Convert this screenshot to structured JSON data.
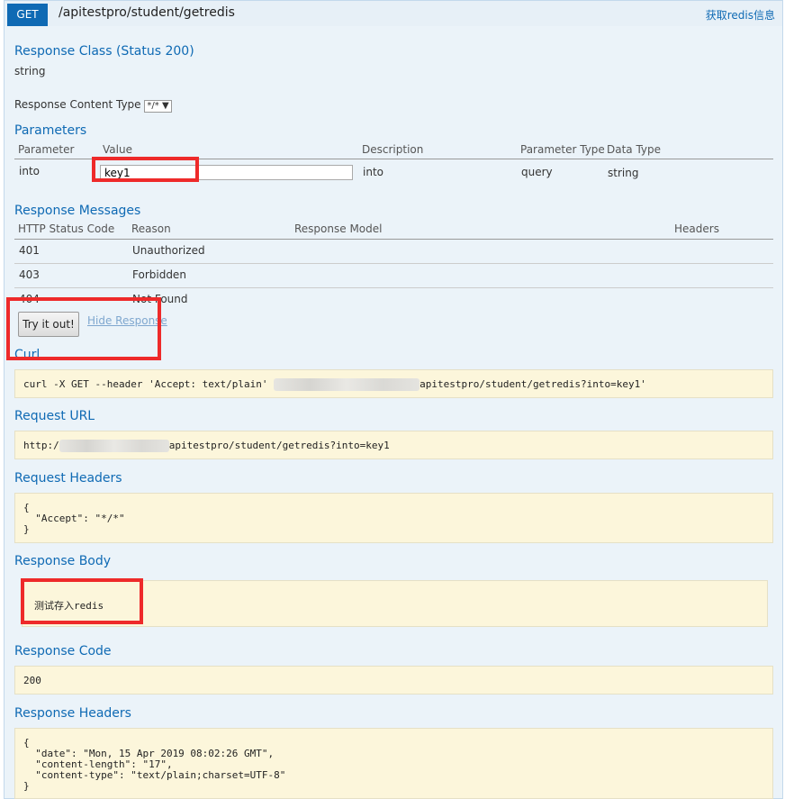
{
  "header": {
    "method": "GET",
    "path": "/apitestpro/student/getredis",
    "summary": "获取redis信息"
  },
  "response_class": {
    "title": "Response Class (Status 200)",
    "type": "string"
  },
  "content_type": {
    "label": "Response Content Type",
    "selected": "*/* ▼"
  },
  "parameters": {
    "title": "Parameters",
    "headers": [
      "Parameter",
      "Value",
      "Description",
      "Parameter Type",
      "Data Type"
    ],
    "row": {
      "name": "into",
      "value": "key1",
      "description": "into",
      "param_type": "query",
      "data_type": "string"
    }
  },
  "response_messages": {
    "title": "Response Messages",
    "headers": [
      "HTTP Status Code",
      "Reason",
      "Response Model",
      "Headers"
    ],
    "rows": [
      {
        "code": "401",
        "reason": "Unauthorized"
      },
      {
        "code": "403",
        "reason": "Forbidden"
      },
      {
        "code": "404",
        "reason": "Not Found"
      }
    ]
  },
  "actions": {
    "try_button": "Try it out!",
    "hide_link": "Hide Response"
  },
  "curl": {
    "title": "Curl",
    "prefix": "curl -X GET --header 'Accept: text/plain' ",
    "suffix": "apitestpro/student/getredis?into=key1'"
  },
  "request_url": {
    "title": "Request URL",
    "prefix": "http:/",
    "suffix": "apitestpro/student/getredis?into=key1"
  },
  "request_headers": {
    "title": "Request Headers",
    "body": "{\n  \"Accept\": \"*/*\"\n}"
  },
  "response_body": {
    "title": "Response Body",
    "body": "测试存入redis"
  },
  "response_code": {
    "title": "Response Code",
    "body": "200"
  },
  "response_headers": {
    "title": "Response Headers",
    "body": "{\n  \"date\": \"Mon, 15 Apr 2019 08:02:26 GMT\",\n  \"content-length\": \"17\",\n  \"content-type\": \"text/plain;charset=UTF-8\"\n}"
  },
  "colors": {
    "accent": "#0f6ab4",
    "highlight": "#ee2a2a",
    "code_bg": "#fcf6db",
    "panel_bg": "#ebf3f9"
  }
}
